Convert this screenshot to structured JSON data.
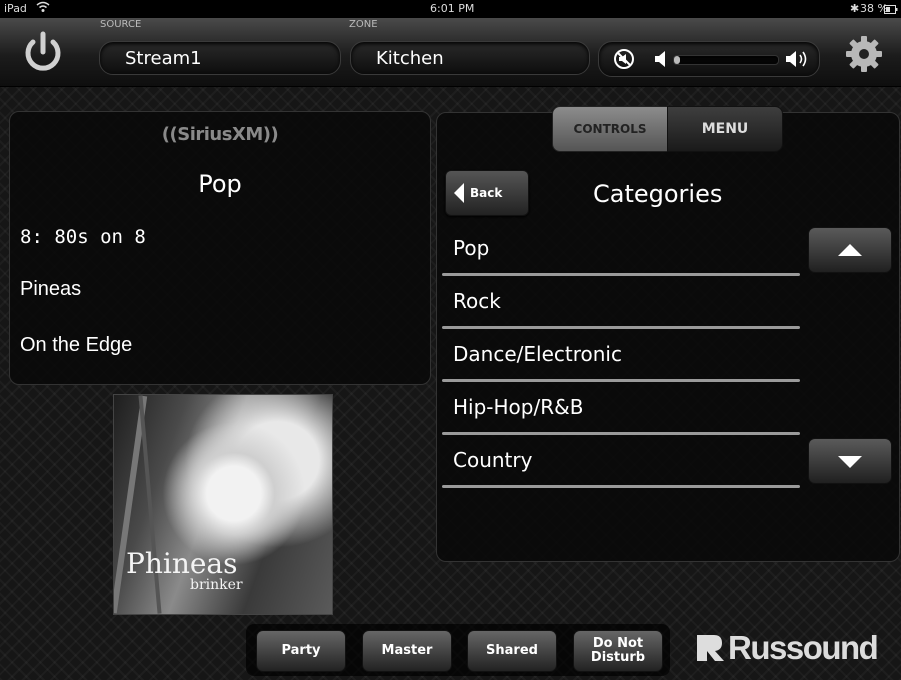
{
  "status_bar": {
    "device": "iPad",
    "time": "6:01 PM",
    "battery": "38 %"
  },
  "header": {
    "source_label": "SOURCE",
    "source_value": "Stream1",
    "zone_label": "ZONE",
    "zone_value": "Kitchen",
    "volume_level": 0.06
  },
  "now_playing": {
    "service_logo": "((SiriusXM))",
    "category": "Pop",
    "channel": "8: 80s on 8",
    "artist": "Pineas",
    "track": "On the Edge",
    "album_art_title": "Phineas",
    "album_art_subtitle": "brinker"
  },
  "browser": {
    "tab_controls": "CONTROLS",
    "tab_menu": "MENU",
    "back_label": "Back",
    "title": "Categories",
    "items": [
      "Pop",
      "Rock",
      "Dance/Electronic",
      "Hip-Hop/R&B",
      "Country"
    ]
  },
  "footer": {
    "party": "Party",
    "master": "Master",
    "shared": "Shared",
    "dnd_line1": "Do Not",
    "dnd_line2": "Disturb",
    "brand": "Russound"
  },
  "icons": {
    "power": "power-icon",
    "mute": "mute-icon",
    "volume_low": "speaker-low-icon",
    "volume_high": "speaker-high-icon",
    "settings": "gear-icon",
    "back": "left-triangle-icon",
    "scroll_up": "up-triangle-icon",
    "scroll_down": "down-triangle-icon"
  }
}
